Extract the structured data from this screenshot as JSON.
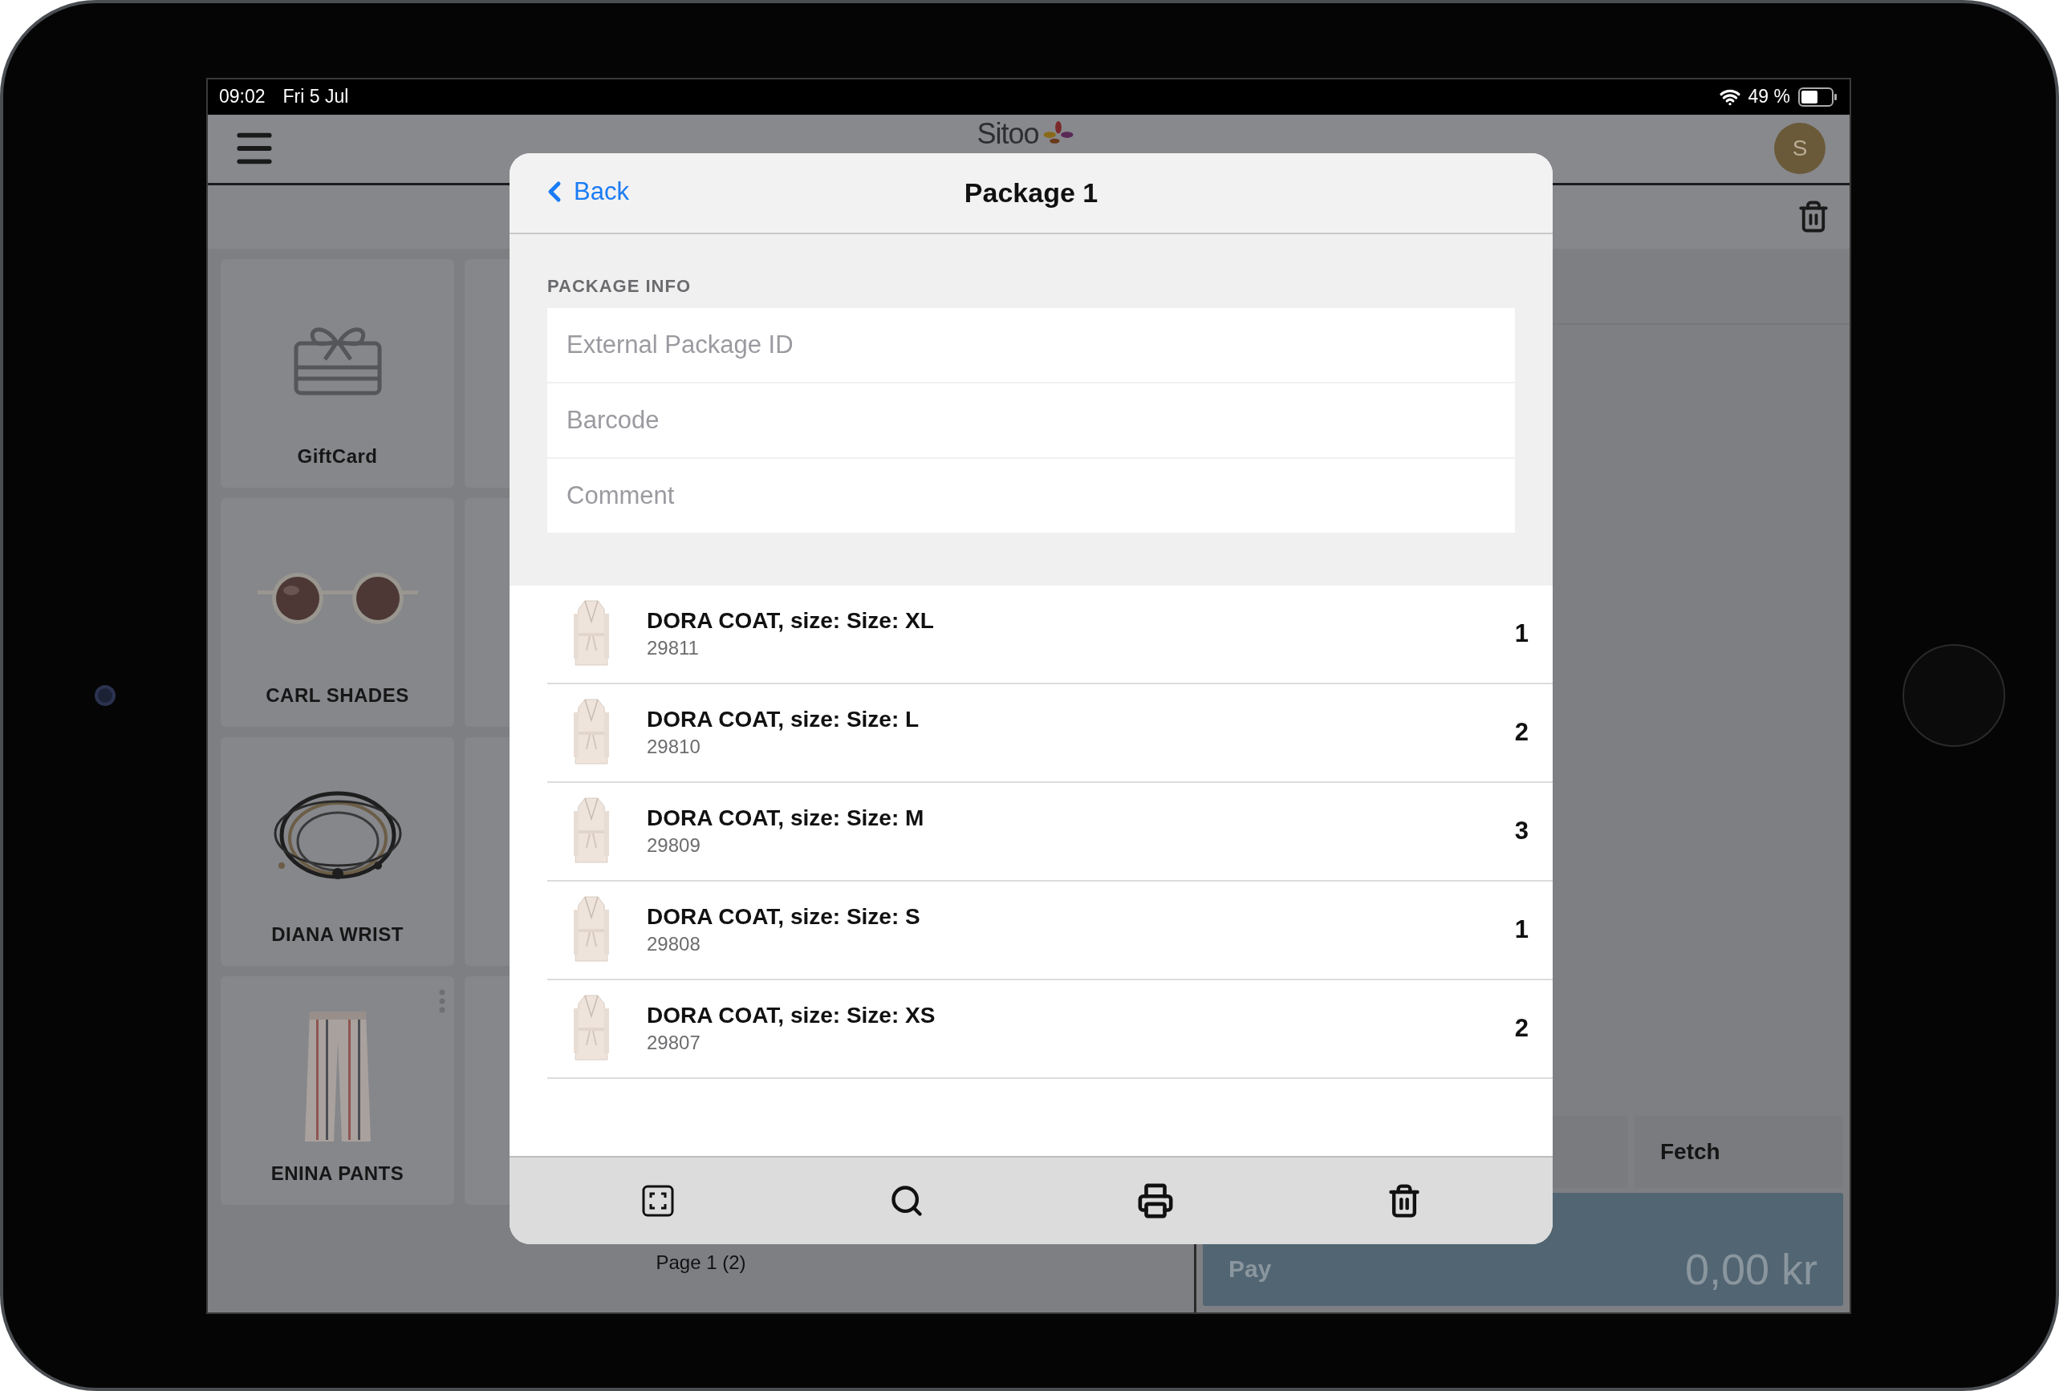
{
  "status_bar": {
    "time": "09:02",
    "date": "Fri 5 Jul",
    "battery": "49 %"
  },
  "header": {
    "logo": "Sitoo",
    "avatar": "S"
  },
  "products": [
    {
      "name": "GiftCard",
      "kind": "giftcard",
      "more_button": false
    },
    {
      "name": "CARL SHADES",
      "kind": "sunglasses",
      "more_button": false
    },
    {
      "name": "DIANA WRIST",
      "kind": "bracelet",
      "more_button": false
    },
    {
      "name": "ENINA PANTS",
      "kind": "pants",
      "more_button": true
    }
  ],
  "pagination": "Page 1 (2)",
  "actions": {
    "fetch": "Fetch",
    "pay": "Pay",
    "total": "0,00 kr"
  },
  "modal": {
    "back": "Back",
    "title": "Package 1",
    "section_title": "PACKAGE INFO",
    "fields": [
      {
        "placeholder": "External Package ID"
      },
      {
        "placeholder": "Barcode"
      },
      {
        "placeholder": "Comment"
      }
    ],
    "items": [
      {
        "name": "DORA COAT, size: Size: XL",
        "sku": "29811",
        "quantity": "1"
      },
      {
        "name": "DORA COAT, size: Size: L",
        "sku": "29810",
        "quantity": "2"
      },
      {
        "name": "DORA COAT, size: Size: M",
        "sku": "29809",
        "quantity": "3"
      },
      {
        "name": "DORA COAT, size: Size: S",
        "sku": "29808",
        "quantity": "1"
      },
      {
        "name": "DORA COAT, size: Size: XS",
        "sku": "29807",
        "quantity": "2"
      }
    ]
  }
}
